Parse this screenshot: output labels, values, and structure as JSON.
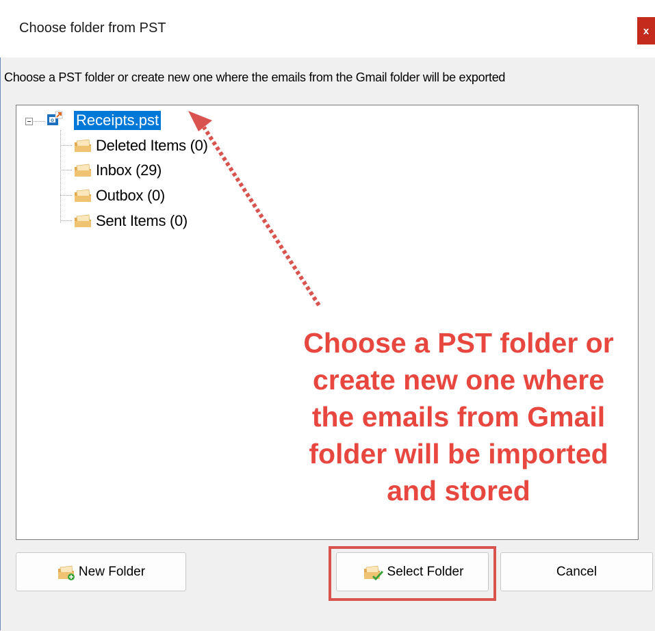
{
  "window": {
    "title": "Choose folder from PST",
    "close_label": "x"
  },
  "instruction": "Choose a PST folder or create new one where the emails from the Gmail folder will be exported",
  "tree": {
    "root": {
      "label": "Receipts.pst",
      "icon": "pst-file-icon",
      "selected": true,
      "expanded": true
    },
    "children": [
      {
        "label": "Deleted Items (0)",
        "icon": "folder-icon"
      },
      {
        "label": "Inbox (29)",
        "icon": "folder-icon"
      },
      {
        "label": "Outbox (0)",
        "icon": "folder-icon"
      },
      {
        "label": "Sent Items (0)",
        "icon": "folder-icon"
      }
    ]
  },
  "buttons": {
    "new_folder": {
      "label": "New Folder",
      "icon": "new-folder-icon"
    },
    "select_folder": {
      "label": "Select Folder",
      "icon": "select-folder-icon"
    },
    "cancel": {
      "label": "Cancel"
    }
  },
  "annotation": {
    "lines": [
      "Choose a PST folder or",
      "create new one where",
      "the emails from Gmail",
      "folder will be imported",
      "and stored"
    ],
    "color": "#e8473f"
  },
  "colors": {
    "selection": "#0078d7",
    "close_button": "#c42b1c",
    "highlight": "#d9534f",
    "folder": "#e8b866"
  }
}
